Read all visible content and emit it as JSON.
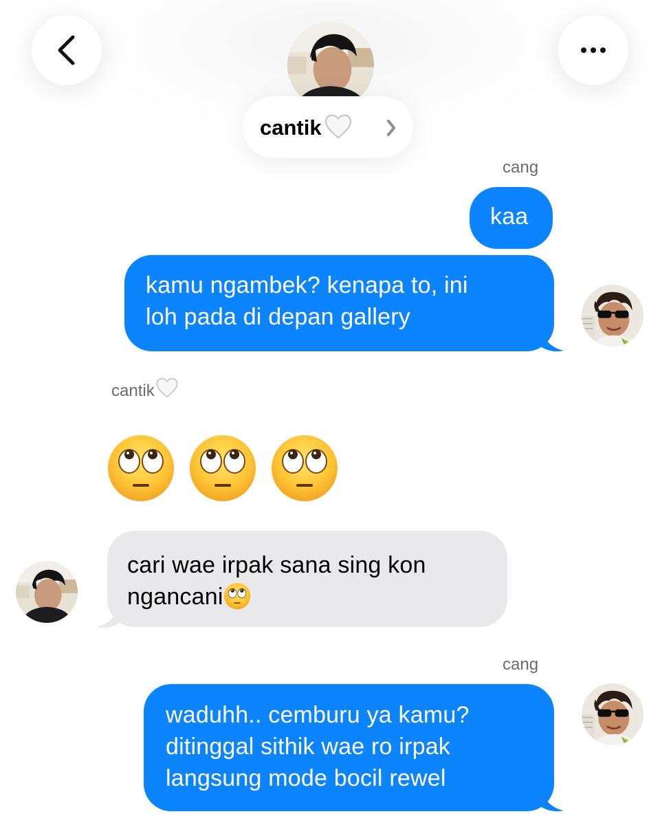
{
  "header": {
    "contact_name": "cantik",
    "back_icon": "chevron-left-icon",
    "more_icon": "ellipsis-icon"
  },
  "messages": [
    {
      "sender": "cang",
      "text": "kaa"
    },
    {
      "text": "kamu ngambek? kenapa to, ini loh pada di depan gallery",
      "lines": [
        "kamu ngambek? kenapa to, ini",
        "loh pada di depan gallery"
      ]
    },
    {
      "sender": "cantik",
      "emoji": "face-with-rolling-eyes",
      "count": 3
    },
    {
      "text": "cari wae irpak sana sing kon ngancani",
      "lines": [
        "cari wae irpak sana sing kon",
        "ngancani"
      ]
    },
    {
      "sender": "cang",
      "text": "waduhh.. cemburu ya kamu? ditinggal sithik wae ro irpak langsung mode bocil rewel",
      "lines": [
        "waduhh.. cemburu ya kamu?",
        "ditinggal sithik wae ro irpak",
        "langsung mode bocil rewel"
      ]
    }
  ],
  "colors": {
    "outgoing_bubble": "#0b84fe",
    "incoming_bubble": "#e9e9eb",
    "label_gray": "#6b6b6f"
  }
}
